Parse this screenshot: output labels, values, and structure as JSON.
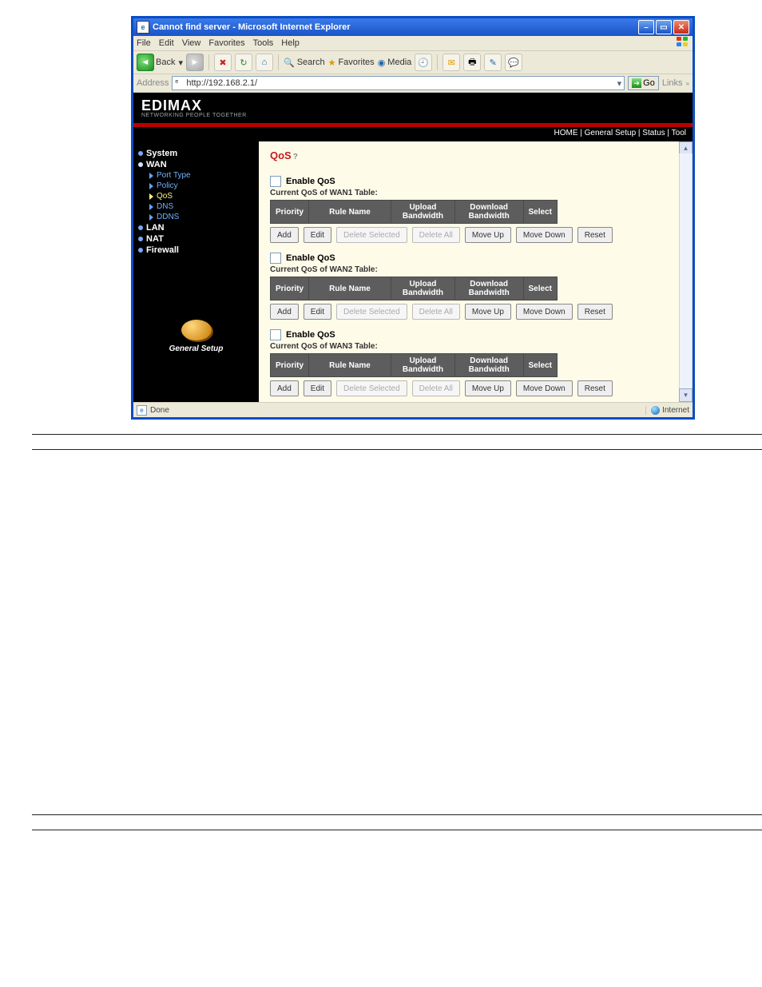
{
  "window": {
    "title": "Cannot find server - Microsoft Internet Explorer"
  },
  "menu": [
    "File",
    "Edit",
    "View",
    "Favorites",
    "Tools",
    "Help"
  ],
  "toolbar": {
    "back": "Back",
    "search": "Search",
    "favorites": "Favorites",
    "media": "Media"
  },
  "addressbar": {
    "label": "Address",
    "url": "http://192.168.2.1/",
    "go": "Go",
    "links": "Links"
  },
  "brand": {
    "name": "EDIMAX",
    "sub": "NETWORKING PEOPLE TOGETHER"
  },
  "topnav": {
    "home": "HOME",
    "gs": "General Setup",
    "status": "Status",
    "tool": "Tool"
  },
  "sidebar": {
    "system": "System",
    "wan": "WAN",
    "wan_items": [
      "Port Type",
      "Policy",
      "QoS",
      "DNS",
      "DDNS"
    ],
    "lan": "LAN",
    "nat": "NAT",
    "firewall": "Firewall",
    "caption": "General Setup"
  },
  "content": {
    "title": "QoS",
    "help": "?",
    "enable": "Enable QoS",
    "tables": [
      "Current QoS of WAN1 Table:",
      "Current QoS of WAN2 Table:",
      "Current QoS of WAN3 Table:"
    ],
    "cols": {
      "priority": "Priority",
      "rule": "Rule Name",
      "up": "Upload Bandwidth",
      "down": "Download Bandwidth",
      "select": "Select"
    },
    "buttons": {
      "add": "Add",
      "edit": "Edit",
      "delsel": "Delete Selected",
      "delall": "Delete All",
      "moveup": "Move Up",
      "movedown": "Move Down",
      "reset": "Reset"
    }
  },
  "status": {
    "done": "Done",
    "zone": "Internet"
  }
}
